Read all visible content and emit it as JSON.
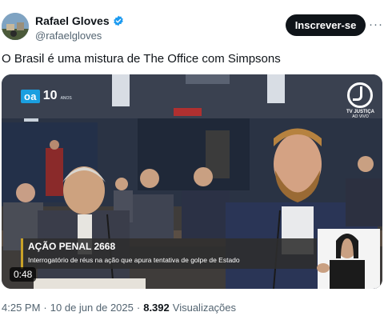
{
  "author": {
    "display_name": "Rafael Gloves",
    "handle": "@rafaelgloves"
  },
  "follow_label": "Inscrever-se",
  "tweet_text": "O Brasil é uma mistura de The Office com Simpsons",
  "video": {
    "channel_logo_text": "oa",
    "channel_logo_number": "10",
    "channel_logo_sub": "ANOS",
    "broadcaster_name": "TV JUSTIÇA",
    "broadcaster_status": "AO VIVO",
    "caption_title": "AÇÃO PENAL 2668",
    "caption_subtitle": "Interrogatório de réus na ação que apura tentativa de golpe de Estado",
    "duration": "0:48"
  },
  "footer": {
    "time": "4:25 PM",
    "date": "10 de jun de 2025",
    "separator": "·",
    "views_count": "8.392",
    "views_label": "Visualizações"
  },
  "colors": {
    "verified_badge": "#1d9bf0",
    "follow_button_bg": "#0f1419",
    "secondary_text": "#536471",
    "caption_accent": "#c9a227"
  }
}
